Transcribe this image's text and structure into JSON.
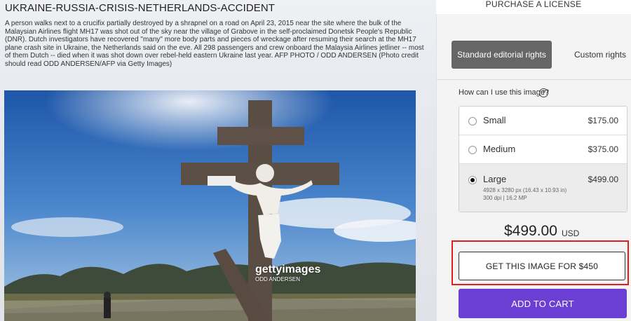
{
  "article": {
    "headline": "UKRAINE-RUSSIA-CRISIS-NETHERLANDS-ACCIDENT",
    "caption": "A person walks next to a crucifix partially destroyed by a shrapnel on a road on April 23, 2015 near the site where the bulk of the Malaysian Airlines flight MH17 was shot out of the sky near the village of Grabove in the self-proclaimed Donetsk People's Republic (DNR). Dutch investigators have recovered \"many\" more body parts and pieces of wreckage after resuming their search at the MH17 plane crash site in Ukraine, the Netherlands said on the eve. All 298 passengers and crew onboard the Malaysia Airlines jetliner -- most of them Dutch -- died when it was shot down over rebel-held eastern Ukraine last year. AFP PHOTO / ODD ANDERSEN (Photo credit should read ODD ANDERSEN/AFP via Getty Images)",
    "watermark": "gettyimages",
    "watermark_credit": "ODD ANDERSEN"
  },
  "license": {
    "heading": "PURCHASE A LICENSE",
    "tabs": [
      {
        "label": "Standard editorial rights",
        "active": true
      },
      {
        "label": "Custom rights",
        "active": false
      }
    ],
    "question": "How can I use this image?",
    "help_icon": "?",
    "options": [
      {
        "name": "Small",
        "price": "$175.00",
        "selected": false
      },
      {
        "name": "Medium",
        "price": "$375.00",
        "selected": false
      },
      {
        "name": "Large",
        "price": "$499.00",
        "selected": true,
        "details": "4928 x 3280 px (16.43 x 10.93 in)",
        "details2": "300 dpi | 16.2 MP"
      }
    ],
    "total": "$499.00",
    "currency": "USD",
    "get_button": "GET THIS IMAGE FOR $450",
    "cart_button": "ADD TO CART"
  },
  "colors": {
    "accent": "#6b3fd4",
    "highlight": "#e02020",
    "tab_active": "#666666"
  }
}
